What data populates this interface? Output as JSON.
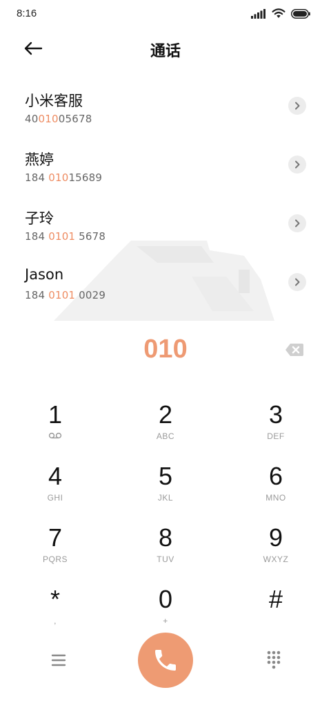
{
  "status_bar": {
    "time": "8:16"
  },
  "header": {
    "title": "通话"
  },
  "contacts": [
    {
      "name": "小米客服",
      "number_pre": "40",
      "number_hl": "010",
      "number_post": "05678"
    },
    {
      "name": "燕婷",
      "number_pre": "184 ",
      "number_hl": "010",
      "number_post": "15689"
    },
    {
      "name": "子玲",
      "number_pre": "184 ",
      "number_hl": "0101",
      "number_post": " 5678"
    },
    {
      "name": "Jason",
      "number_pre": "184 ",
      "number_hl": "0101",
      "number_post": " 0029"
    }
  ],
  "dial": {
    "number": "010"
  },
  "keypad": [
    {
      "digit": "1",
      "sub": ""
    },
    {
      "digit": "2",
      "sub": "ABC"
    },
    {
      "digit": "3",
      "sub": "DEF"
    },
    {
      "digit": "4",
      "sub": "GHI"
    },
    {
      "digit": "5",
      "sub": "JKL"
    },
    {
      "digit": "6",
      "sub": "MNO"
    },
    {
      "digit": "7",
      "sub": "PQRS"
    },
    {
      "digit": "8",
      "sub": "TUV"
    },
    {
      "digit": "9",
      "sub": "WXYZ"
    },
    {
      "digit": "*",
      "sub": ","
    },
    {
      "digit": "0",
      "sub": "+"
    },
    {
      "digit": "#",
      "sub": ""
    }
  ],
  "icons": {
    "signal": "signal-icon",
    "wifi": "wifi-icon",
    "battery": "battery-icon",
    "back": "back-arrow-icon",
    "chevron": "chevron-right-icon",
    "backspace": "backspace-icon",
    "voicemail": "voicemail-icon",
    "menu": "menu-icon",
    "call": "phone-icon",
    "dialpad": "dialpad-icon"
  },
  "colors": {
    "accent": "#ee9b73",
    "highlight_text": "#ee8c62",
    "chevron_bg": "#ececec"
  }
}
